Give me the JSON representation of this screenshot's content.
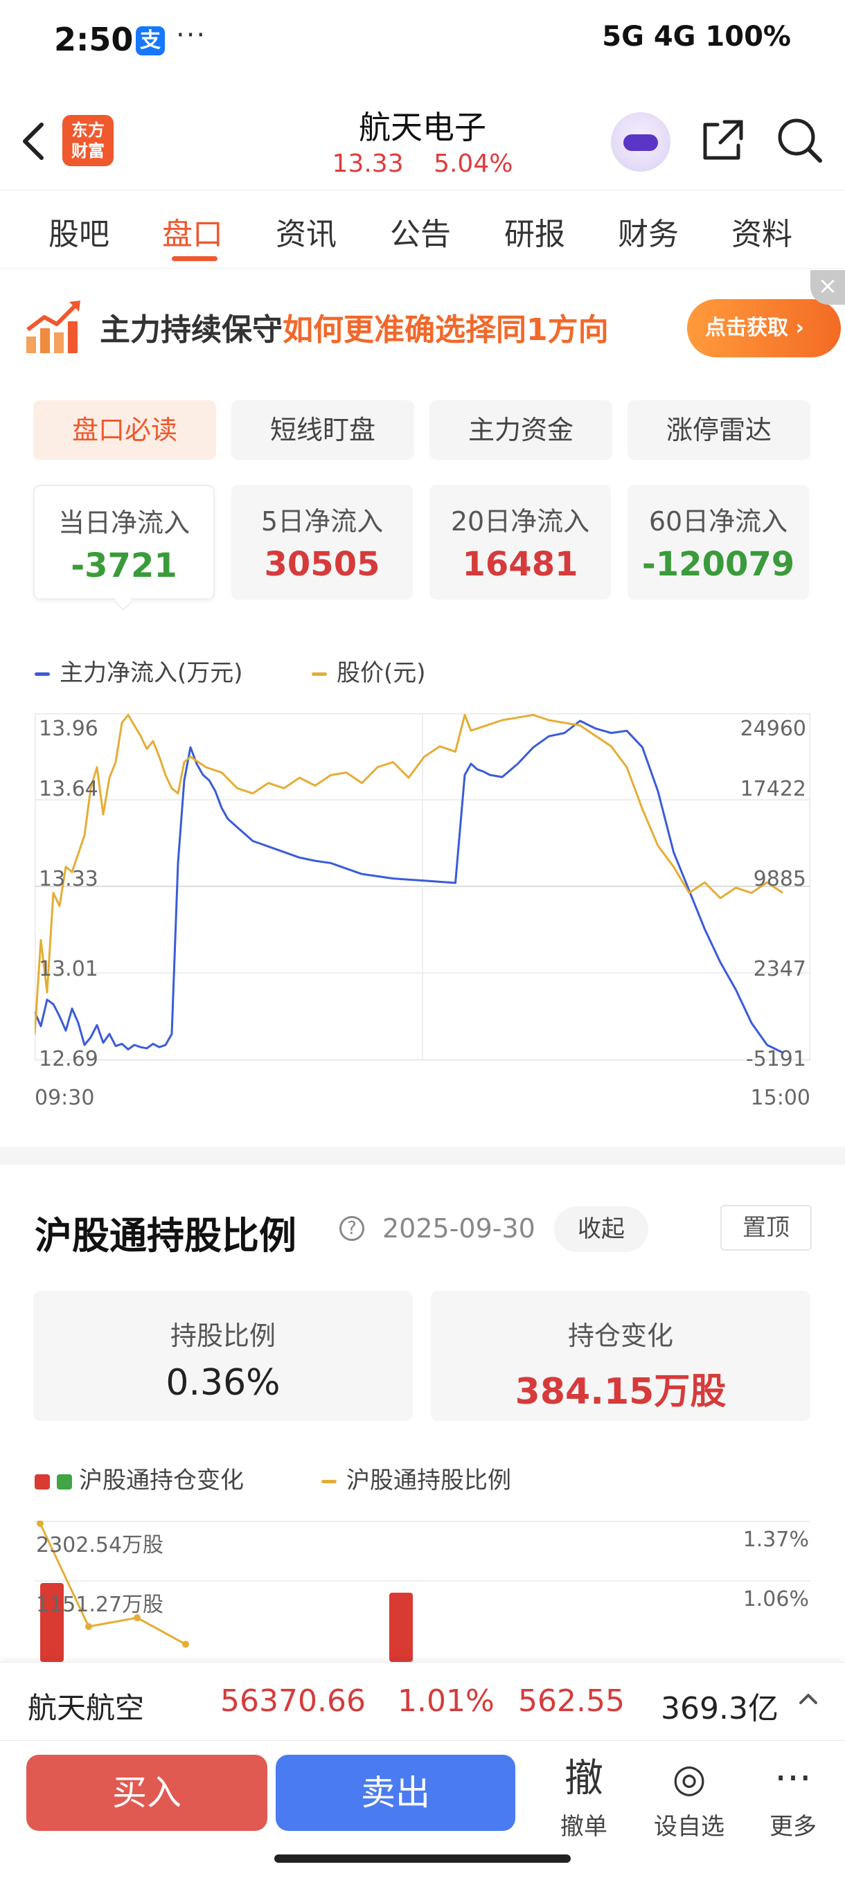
{
  "status_bar": {
    "time": "2:50",
    "app_icon": "支",
    "dots": "···",
    "right": "5G 4G 100%"
  },
  "header": {
    "logo_line1": "东方",
    "logo_line2": "财富",
    "title": "航天电子",
    "price": "13.33",
    "change_pct": "5.04%"
  },
  "tabs": [
    "股吧",
    "盘口",
    "资讯",
    "公告",
    "研报",
    "财务",
    "资料"
  ],
  "banner": {
    "text_dark": "主力持续保守",
    "text_highlight": "如何更准确选择同1方向",
    "button": "点击获取",
    "close": "×"
  },
  "sub_tabs": [
    "盘口必读",
    "短线盯盘",
    "主力资金",
    "涨停雷达"
  ],
  "flow_cards": [
    {
      "label": "当日净流入",
      "value": "-3721"
    },
    {
      "label": "5日净流入",
      "value": "30505"
    },
    {
      "label": "20日净流入",
      "value": "16481"
    },
    {
      "label": "60日净流入",
      "value": "-120079"
    }
  ],
  "chart_data": [
    {
      "type": "line",
      "legend": [
        "主力净流入(万元)",
        "股价(元)"
      ],
      "left_ticks": [
        "13.96",
        "13.64",
        "13.33",
        "13.01",
        "12.69"
      ],
      "right_ticks": [
        "24960",
        "17422",
        "9885",
        "2347",
        "-5191"
      ],
      "x_ticks": [
        "09:30",
        "15:00"
      ],
      "x_range": [
        0,
        240
      ],
      "price_ylim": [
        12.69,
        13.96
      ],
      "flow_ylim": [
        -5191,
        24960
      ],
      "series": [
        {
          "name": "主力净流入(万元)",
          "color": "#3a5bd9",
          "x": [
            0,
            2,
            4,
            6,
            8,
            10,
            12,
            14,
            16,
            18,
            20,
            22,
            24,
            26,
            28,
            30,
            32,
            34,
            36,
            38,
            40,
            42,
            44,
            46,
            48,
            50,
            52,
            54,
            56,
            58,
            60,
            62,
            64,
            66,
            68,
            70,
            75,
            80,
            85,
            90,
            95,
            100,
            105,
            110,
            115,
            120,
            125,
            130,
            135,
            138,
            140,
            142,
            144,
            146,
            150,
            155,
            160,
            165,
            170,
            175,
            180,
            185,
            190,
            195,
            200,
            205,
            210,
            215,
            220,
            225,
            230,
            235,
            240
          ],
          "y": [
            -1500,
            -2800,
            -400,
            -800,
            -1900,
            -3200,
            -1200,
            -2500,
            -4500,
            -3800,
            -2700,
            -4300,
            -3500,
            -4600,
            -4400,
            -4900,
            -4500,
            -4700,
            -4800,
            -4400,
            -4700,
            -4500,
            -3500,
            12000,
            19500,
            22500,
            21000,
            20000,
            19500,
            18500,
            17000,
            16000,
            15500,
            15000,
            14500,
            14000,
            13500,
            13000,
            12500,
            12200,
            12000,
            11500,
            11000,
            10800,
            10600,
            10500,
            10400,
            10300,
            10200,
            20000,
            21000,
            20500,
            20300,
            20000,
            19800,
            21000,
            22500,
            23500,
            23800,
            24900,
            24200,
            23800,
            24000,
            22500,
            18500,
            13000,
            9500,
            6000,
            3000,
            500,
            -2500,
            -4500,
            -5191
          ]
        },
        {
          "name": "股价(元)",
          "color": "#e5ad35",
          "x": [
            0,
            2,
            4,
            6,
            8,
            10,
            12,
            14,
            16,
            18,
            20,
            22,
            24,
            26,
            28,
            30,
            32,
            34,
            36,
            38,
            40,
            42,
            44,
            46,
            48,
            50,
            55,
            60,
            65,
            70,
            75,
            80,
            85,
            90,
            95,
            100,
            105,
            110,
            115,
            120,
            125,
            130,
            135,
            138,
            140,
            145,
            150,
            155,
            160,
            165,
            170,
            175,
            180,
            185,
            190,
            195,
            200,
            205,
            210,
            215,
            220,
            225,
            230,
            235,
            240
          ],
          "y": [
            12.76,
            13.12,
            12.92,
            13.3,
            13.25,
            13.4,
            13.38,
            13.45,
            13.52,
            13.7,
            13.78,
            13.6,
            13.74,
            13.8,
            13.95,
            13.98,
            13.94,
            13.9,
            13.85,
            13.88,
            13.82,
            13.75,
            13.7,
            13.68,
            13.8,
            13.82,
            13.78,
            13.76,
            13.7,
            13.68,
            13.72,
            13.7,
            13.74,
            13.71,
            13.75,
            13.76,
            13.72,
            13.78,
            13.8,
            13.74,
            13.82,
            13.86,
            13.84,
            13.98,
            13.92,
            13.94,
            13.96,
            13.97,
            13.98,
            13.96,
            13.95,
            13.94,
            13.9,
            13.86,
            13.78,
            13.62,
            13.48,
            13.4,
            13.3,
            13.34,
            13.28,
            13.32,
            13.3,
            13.34,
            13.3
          ]
        }
      ]
    },
    {
      "type": "bar",
      "legend": [
        "沪股通持仓变化",
        "沪股通持股比例"
      ],
      "left_ticks": [
        "2302.54万股",
        "1151.27万股"
      ],
      "right_ticks": [
        "1.37%",
        "1.06%"
      ],
      "bar_color_up": "#d93a32",
      "bar_color_down": "#3fa545",
      "line_color": "#e5ad35",
      "line_points": [
        [
          0,
          1.37
        ],
        [
          1,
          1.02
        ],
        [
          2,
          1.05
        ],
        [
          3,
          0.96
        ]
      ]
    }
  ],
  "hsgt": {
    "title": "沪股通持股比例",
    "help": "?",
    "date": "2025-09-30",
    "collapse": "收起",
    "pin": "置顶",
    "stats": [
      {
        "label": "持股比例",
        "value": "0.36%"
      },
      {
        "label": "持仓变化",
        "value": "384.15万股"
      }
    ]
  },
  "ticker": {
    "name": "航天航空",
    "price": "56370.66",
    "pct": "1.01%",
    "change": "562.55",
    "amount": "369.3亿"
  },
  "bottom_bar": {
    "buy": "买入",
    "sell": "卖出",
    "items": [
      {
        "icon": "撤",
        "label": "撤单"
      },
      {
        "icon": "◎",
        "label": "设自选"
      },
      {
        "icon": "···",
        "label": "更多"
      }
    ]
  },
  "colors": {
    "accent": "#f0582d",
    "up": "#d63b3b",
    "down": "#3a9b3a"
  }
}
